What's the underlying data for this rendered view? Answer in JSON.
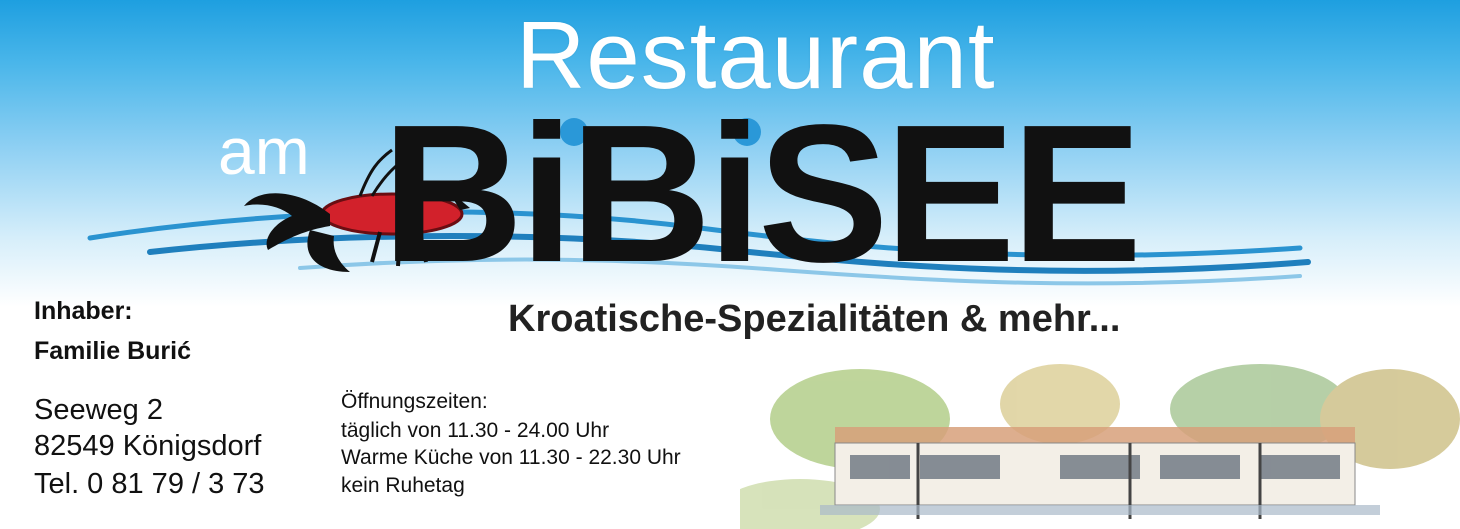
{
  "brand": {
    "line1": "Restaurant",
    "am": "am",
    "name": "BiBiSEE",
    "tagline": "Kroatische-Spezialitäten & mehr..."
  },
  "owner": {
    "label": "Inhaber:",
    "name": "Familie Burić"
  },
  "address": {
    "street": "Seeweg 2",
    "city": "82549 Königsdorf",
    "phone": "Tel. 0 81 79 / 3 73"
  },
  "hours": {
    "title": "Öffnungszeiten:",
    "line1": "täglich von 11.30 - 24.00 Uhr",
    "line2": "Warme Küche von 11.30 - 22.30 Uhr",
    "line3": "kein Ruhetag"
  },
  "colors": {
    "sky": "#1e9fe0",
    "wave": "#1f8fc8",
    "lobster": "#d2212b",
    "text": "#111111"
  },
  "icons": [
    "lobster-icon",
    "wave-lines",
    "restaurant-building-illustration"
  ]
}
